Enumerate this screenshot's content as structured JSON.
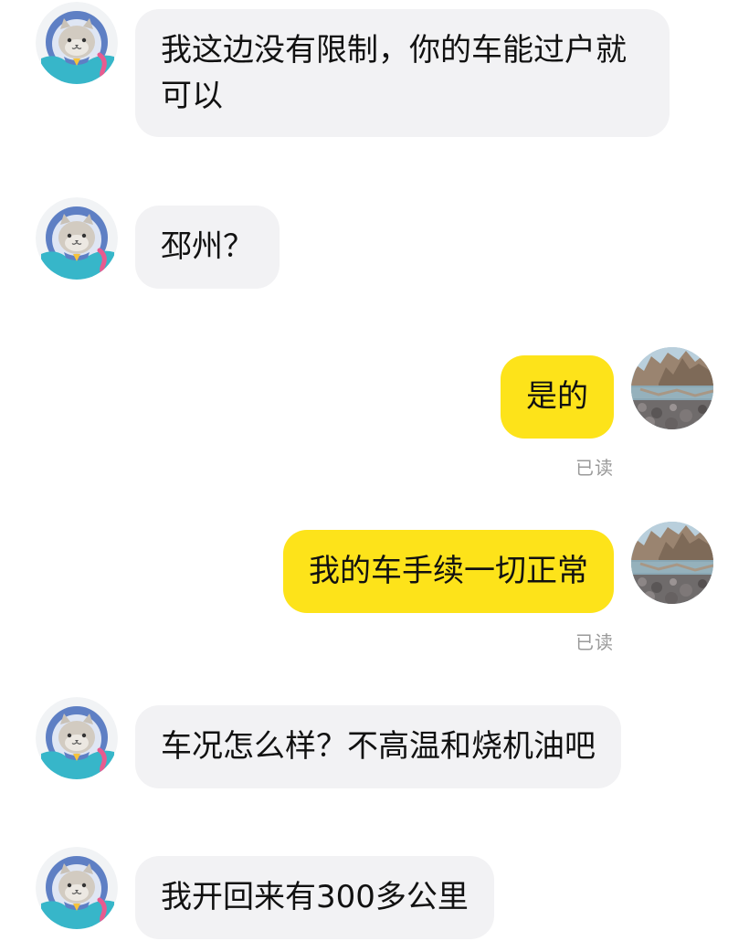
{
  "messages": [
    {
      "side": "received",
      "text": "我这边没有限制，你的车能过户就可以"
    },
    {
      "side": "received",
      "text": "邳州？"
    },
    {
      "side": "sent",
      "text": "是的",
      "status": "已读"
    },
    {
      "side": "sent",
      "text": "我的车手续一切正常",
      "status": "已读"
    },
    {
      "side": "received",
      "text": "车况怎么样？不高温和烧机油吧"
    },
    {
      "side": "received",
      "text": "我开回来有300多公里"
    }
  ],
  "avatars": {
    "other": "cat-astronaut-avatar",
    "self": "lake-landscape-avatar"
  },
  "colors": {
    "sent_bubble": "#fde31a",
    "received_bubble": "#f2f2f4",
    "read_status": "#9a9a9a"
  }
}
